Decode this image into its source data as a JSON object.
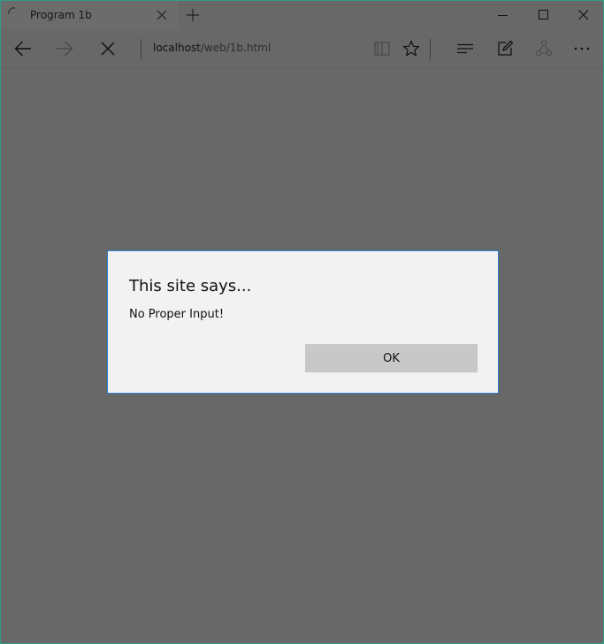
{
  "tab": {
    "title": "Program 1b"
  },
  "address_bar": {
    "host": "localhost",
    "path": "/web/1b.html"
  },
  "dialog": {
    "title": "This site says...",
    "message": "No Proper Input!",
    "ok_label": "OK"
  },
  "icons": {
    "tab": [
      "loading-spinner-icon",
      "close-icon",
      "plus-icon"
    ],
    "window": [
      "minimize-icon",
      "maximize-icon",
      "close-icon"
    ],
    "nav": [
      "back-arrow-icon",
      "forward-arrow-icon",
      "stop-loading-icon"
    ],
    "toolbar": [
      "reading-view-icon",
      "star-icon",
      "hub-icon",
      "web-note-icon",
      "share-icon",
      "more-icon"
    ]
  },
  "colors": {
    "window_border": "#2f9c86",
    "dialog_border": "#2b7fd3",
    "overlay": "#686868",
    "dialog_bg": "#f2f2f2",
    "ok_button_bg": "#c8c8c8"
  }
}
